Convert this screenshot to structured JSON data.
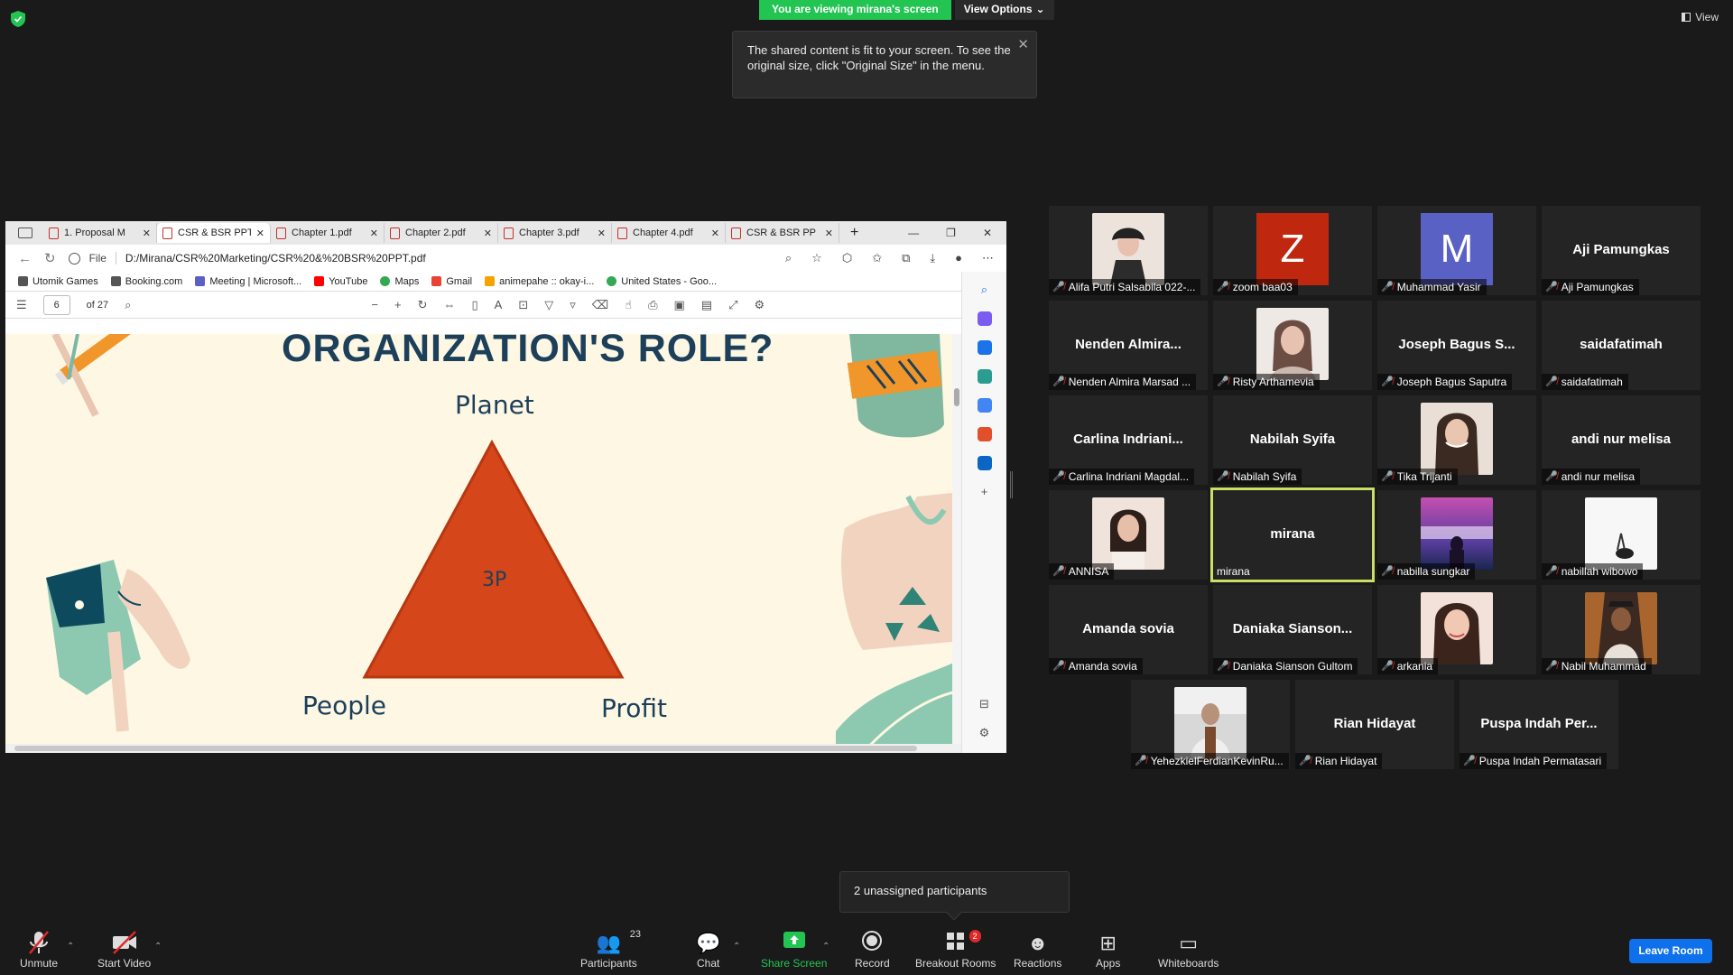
{
  "top": {
    "viewing_label": "You are viewing mirana's screen",
    "view_options": "View Options",
    "view": "View"
  },
  "tooltip": {
    "text": "The shared content is fit to your screen. To see the original size, click \"Original Size\" in the menu."
  },
  "browser": {
    "tabs": [
      {
        "label": "1. Proposal M"
      },
      {
        "label": "CSR & BSR PPT"
      },
      {
        "label": "Chapter 1.pdf"
      },
      {
        "label": "Chapter 2.pdf"
      },
      {
        "label": "Chapter 3.pdf"
      },
      {
        "label": "Chapter 4.pdf"
      },
      {
        "label": "CSR & BSR PP"
      }
    ],
    "url_scheme": "File",
    "url": "D:/Mirana/CSR%20Marketing/CSR%20&%20BSR%20PPT.pdf",
    "bookmarks": [
      {
        "label": "Utomik Games",
        "color": "#555555"
      },
      {
        "label": "Booking.com",
        "color": "#555555"
      },
      {
        "label": "Meeting | Microsoft...",
        "color": "#5b5fc7"
      },
      {
        "label": "YouTube",
        "color": "#ff0000"
      },
      {
        "label": "Maps",
        "color": "#34a853"
      },
      {
        "label": "Gmail",
        "color": "#ea4335"
      },
      {
        "label": "animepahe :: okay-i...",
        "color": "#f4a300"
      },
      {
        "label": "United States - Goo...",
        "color": "#34a853"
      }
    ],
    "pdf": {
      "page": "6",
      "of": "of 27"
    }
  },
  "slide": {
    "title": "ORGANIZATION'S ROLE?",
    "planet": "Planet",
    "people": "People",
    "profit": "Profit",
    "center": "3P",
    "triangle_color": "#d5461b"
  },
  "participants": [
    {
      "short": "",
      "name": "Alifa Putri Salsabila 022-...",
      "type": "photo",
      "color": "#d8c8c0"
    },
    {
      "short": "Z",
      "name": "zoom baa03",
      "type": "letter",
      "color": "#c0270f"
    },
    {
      "short": "M",
      "name": "Muhammad Yasir",
      "type": "letter",
      "color": "#5961c4"
    },
    {
      "short": "Aji Pamungkas",
      "name": "Aji Pamungkas",
      "type": "text"
    },
    {
      "short": "Nenden Almira...",
      "name": "Nenden Almira Marsad ...",
      "type": "text"
    },
    {
      "short": "",
      "name": "Risty Arthamevia",
      "type": "photo",
      "color": "#c6a89a"
    },
    {
      "short": "Joseph Bagus S...",
      "name": "Joseph Bagus Saputra",
      "type": "text"
    },
    {
      "short": "saidafatimah",
      "name": "saidafatimah",
      "type": "text"
    },
    {
      "short": "Carlina Indriani...",
      "name": "Carlina Indriani Magdal...",
      "type": "text"
    },
    {
      "short": "Nabilah Syifa",
      "name": "Nabilah Syifa",
      "type": "text"
    },
    {
      "short": "",
      "name": "Tika Trijanti",
      "type": "photo",
      "color": "#b89c8c"
    },
    {
      "short": "andi nur melisa",
      "name": "andi nur melisa",
      "type": "text"
    },
    {
      "short": "",
      "name": "ANNISA",
      "type": "photo",
      "color": "#e8d8cc"
    },
    {
      "short": "mirana",
      "name": "mirana",
      "type": "text",
      "speaking": true
    },
    {
      "short": "",
      "name": "nabilla sungkar",
      "type": "photo",
      "color": "#8a4f9e"
    },
    {
      "short": "",
      "name": "nabillah wibowo",
      "type": "photo",
      "color": "#f4f4f4"
    },
    {
      "short": "Amanda sovia",
      "name": "Amanda sovia",
      "type": "text"
    },
    {
      "short": "Daniaka Sianson...",
      "name": "Daniaka Sianson Gultom",
      "type": "text"
    },
    {
      "short": "",
      "name": "arkania",
      "type": "photo",
      "color": "#c4937e"
    },
    {
      "short": "",
      "name": "Nabil Muhammad",
      "type": "photo",
      "color": "#7a4a2e"
    },
    {
      "short": "",
      "name": "YehezkielFerdianKevinRu...",
      "type": "photo",
      "color": "#9a9a9a"
    },
    {
      "short": "Rian Hidayat",
      "name": "Rian Hidayat",
      "type": "text"
    },
    {
      "short": "Puspa Indah Per...",
      "name": "Puspa Indah Permatasari",
      "type": "text"
    }
  ],
  "unassigned": "2 unassigned participants",
  "toolbar": {
    "unmute": "Unmute",
    "start_video": "Start Video",
    "participants": "Participants",
    "participants_count": "23",
    "chat": "Chat",
    "share_screen": "Share Screen",
    "record": "Record",
    "breakout_rooms": "Breakout Rooms",
    "breakout_badge": "2",
    "reactions": "Reactions",
    "apps": "Apps",
    "whiteboards": "Whiteboards",
    "leave": "Leave Room"
  }
}
